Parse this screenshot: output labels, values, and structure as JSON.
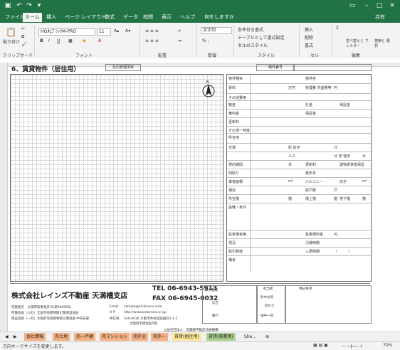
{
  "menus": [
    "ファイル",
    "ホーム",
    "挿入",
    "ページ レイアウト",
    "数式",
    "データ",
    "校閲",
    "表示",
    "ヘルプ",
    "何をしますか"
  ],
  "share_label": "共有",
  "ribbon": {
    "clipboard": {
      "paste": "貼り付け",
      "label": "クリップボード"
    },
    "font": {
      "name": "HG丸ｺﾞｼｯｸM-PRO",
      "size": "11",
      "label": "フォント"
    },
    "alignment": {
      "label": "配置"
    },
    "number": {
      "format": "文字列",
      "label": "数値"
    },
    "styles": {
      "conditional": "条件付き書式",
      "table": "テーブルとして書式設定",
      "cell": "セルのスタイル",
      "label": "スタイル"
    },
    "cells": {
      "insert": "挿入",
      "delete": "削除",
      "format": "書式",
      "label": "セル"
    },
    "editing": {
      "sort": "並べ替えと フィルター",
      "find": "検索と 選択",
      "label": "編集"
    }
  },
  "sheet": {
    "title": "6、賃貸物件（居住用）",
    "header_box1": "社内管理項目",
    "header_box2": "物件番号",
    "right_rows": [
      {
        "label": "物件種目",
        "label2": "物件名"
      },
      {
        "label": "賃料",
        "value": "万円",
        "label2": "管理費 共益費等",
        "value2": "円"
      },
      {
        "label": "その他費用"
      },
      {
        "label": "敷金",
        "label2": "礼金",
        "label3": "保証金"
      },
      {
        "label": "権利金",
        "label2": "保証金"
      },
      {
        "label": "更新料"
      },
      {
        "label": "その他一時金"
      },
      {
        "label": "所在地"
      },
      {
        "label": "交通",
        "value": "駅 徒歩",
        "value2": "分"
      },
      {
        "label": "",
        "value": "バス",
        "value2": "分 停 徒歩",
        "value3": "分"
      },
      {
        "label": "契約期間",
        "value": "年",
        "label2": "更新料",
        "label3": "建物賃貸借保証"
      },
      {
        "label": "間取り",
        "label2": "築年月"
      },
      {
        "label": "専有面積",
        "value": "m²",
        "label2": "バルコニー",
        "label3": "向き",
        "value3": "m²"
      },
      {
        "label": "構造",
        "label2": "総戸数",
        "value2": "戸"
      },
      {
        "label": "所在階",
        "value": "階",
        "label2": "階上階",
        "value2": "階",
        "label3": "地下階",
        "value3": "階"
      },
      {
        "label": "設備・条件"
      },
      {
        "label": "駐車場有無",
        "label2": "駐車場料金",
        "value2": "円"
      },
      {
        "label": "現況",
        "label2": "引渡時期"
      },
      {
        "label": "取引態様",
        "label2": "入居時期",
        "value2": "（　　　）"
      },
      {
        "label": "備考"
      }
    ]
  },
  "footer": {
    "company": "株式会社レインズ不動産 天満橋支店",
    "tel": "TEL 06-6943-5913",
    "fax": "FAX 06-6945-0032",
    "license": "宅建免許　大阪府知事免許(5)第99999号",
    "assoc1": "所属協会（公社）全国宅地建物取引業保証協会",
    "assoc2": "保証協会（一社）大阪府宅地建物取引業協会 中央支部",
    "email_label": "Email",
    "email": "sample@kinkireins.com",
    "hp_label": "H P",
    "hp": "http://www.kinkireins.or.jp/",
    "addr_label": "所在地",
    "addr": "540-0036 大阪市中央区船越町2-2-1",
    "addr2": "大阪府宅建会館5階",
    "col_labels": [
      "取引態様",
      "広告",
      "媒介"
    ],
    "staff_labels": [
      "担当者",
      "特記事項",
      "鈴木太郎",
      "取引士",
      "田中一郎"
    ],
    "bottom_note": "公益社団法人　近畿圏不動産流通機構"
  },
  "tabs": [
    "会社情報",
    "売土地",
    "売一戸建",
    "売マンション",
    "売外全",
    "売外一",
    "賃貸(居住用)",
    "賃貸(事業用)",
    "She..."
  ],
  "status": {
    "text": "方向キーでサイズを変更します。",
    "zoom": "70%"
  },
  "colors": {
    "excel_green": "#217346",
    "tab_orange": "#f4b183",
    "tab_green": "#a9d08e",
    "tab_yellow": "#ffe699"
  }
}
